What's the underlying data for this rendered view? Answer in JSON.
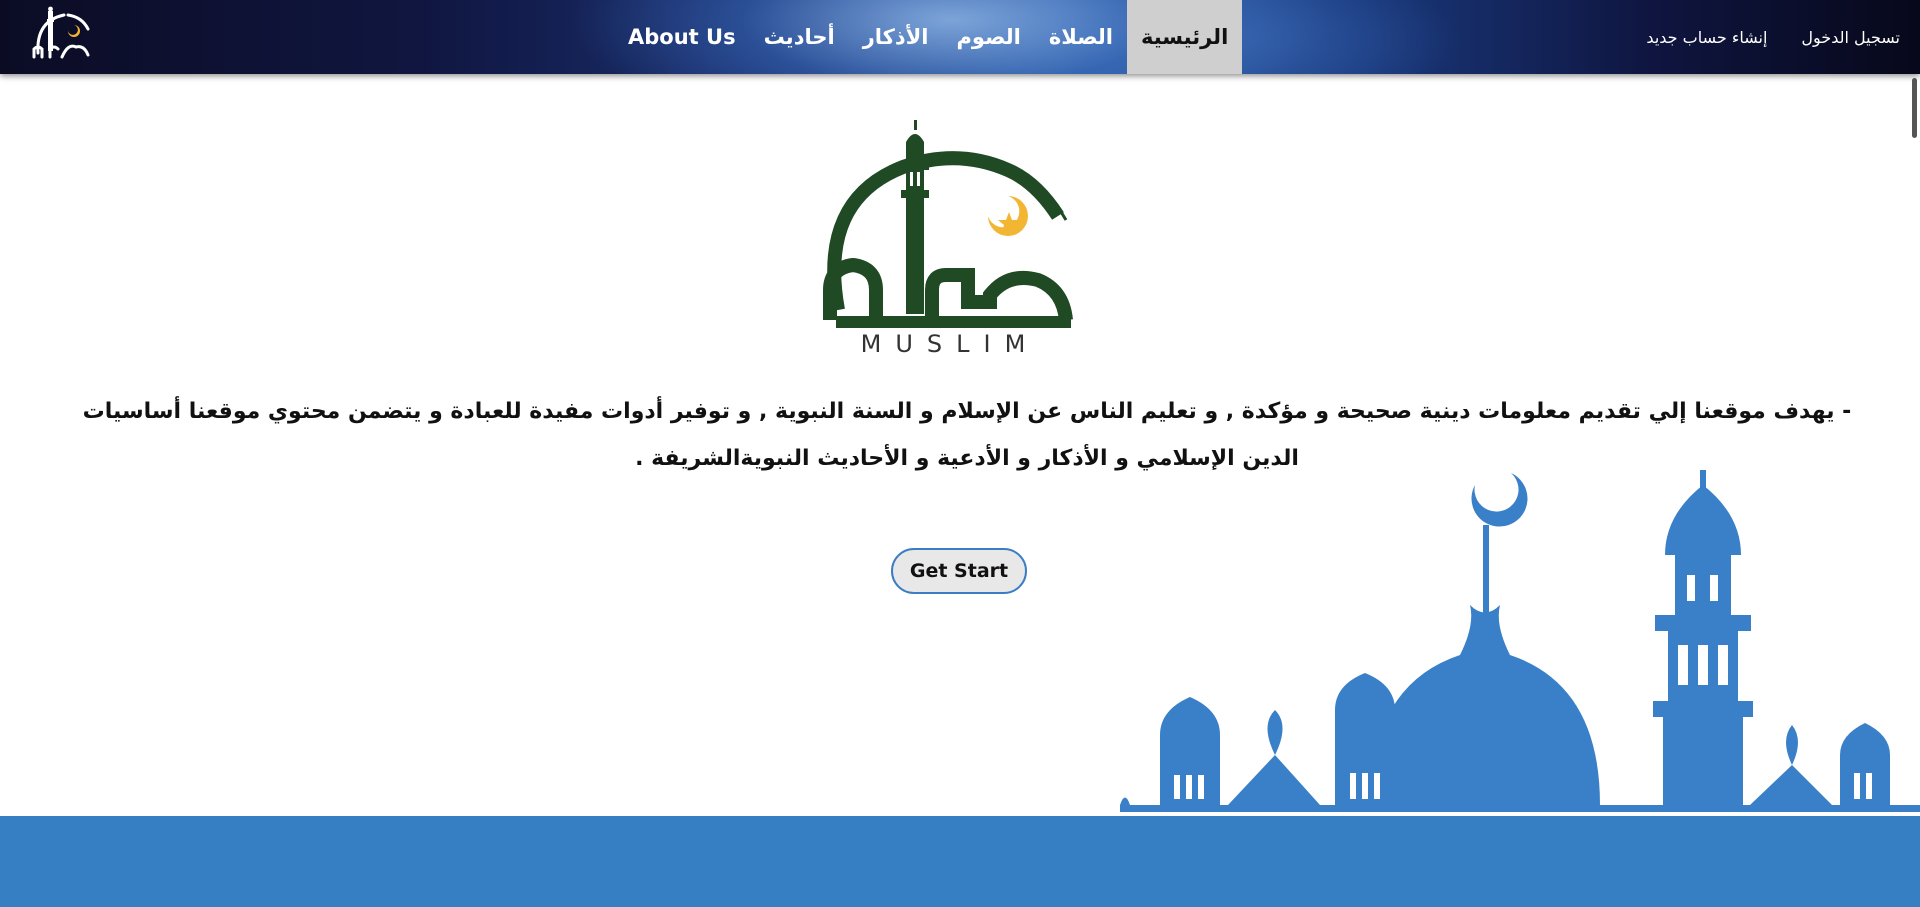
{
  "nav": {
    "logo_icon": "mosque-crescent-logo-icon",
    "links": [
      {
        "label": "About Us",
        "active": false
      },
      {
        "label": "أحاديث",
        "active": false
      },
      {
        "label": "الأذكار",
        "active": false
      },
      {
        "label": "الصوم",
        "active": false
      },
      {
        "label": "الصلاة",
        "active": false
      },
      {
        "label": "الرئيسية",
        "active": true
      }
    ],
    "auth": {
      "register_label": "إنشاء حساب جديد",
      "login_label": "تسجيل الدخول"
    }
  },
  "hero": {
    "brand_word": "MUSLIM",
    "description": "- يهدف موقعنا إلي تقديم معلومات دينية صحيحة و مؤكدة , و تعليم الناس عن الإسلام و السنة النبوية , و توفير أدوات مفيدة للعبادة و يتضمن محتوي موقعنا أساسيات الدين الإسلامي و الأذكار و الأدعية و الأحاديث النبويةالشريفة .",
    "cta_label": "Get Start"
  },
  "colors": {
    "brand_green": "#1f4a24",
    "crescent_gold": "#f2b632",
    "accent_blue": "#377fc3",
    "nav_active_bg": "#cfcfcf"
  }
}
